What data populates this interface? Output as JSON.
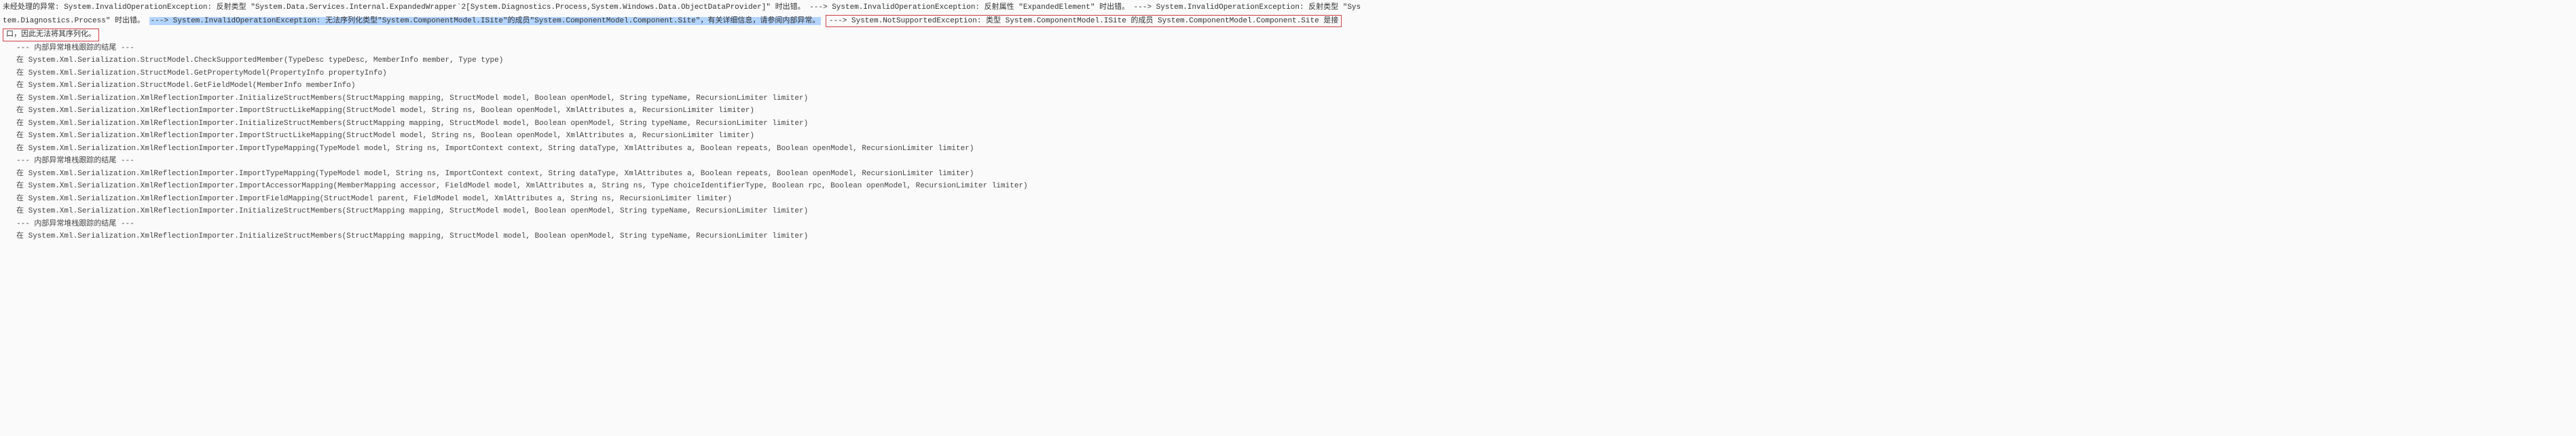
{
  "header": {
    "prefix": "未经处理的异常:  System.InvalidOperationException: 反射类型",
    "type1": "\"System.Data.Services.Internal.ExpandedWrapper`2[System.Diagnostics.Process,System.Windows.Data.ObjectDataProvider]\"",
    "err1": "时出错。 ---> System.InvalidOperationException: 反射属性",
    "prop1": "\"ExpandedElement\"",
    "err2": "时出错。 ---> System.InvalidOperationException: 反射类型",
    "type2": "\"Sys",
    "line2_start": "tem.Diagnostics.Process\"",
    "line2_err": "时出错。",
    "highlighted": "---> System.InvalidOperationException: 无法序列化类型\"System.ComponentModel.ISite\"的成员\"System.ComponentModel.Component.Site\"，有关详细信息，请参阅内部异常。",
    "boxed1": "---> System.NotSupportedException: 类型 System.ComponentModel.ISite 的成员 System.ComponentModel.Component.Site 是接",
    "boxed2": "口，因此无法将其序列化。"
  },
  "traces": [
    "   --- 内部异常堆栈跟踪的结尾 ---",
    "   在 System.Xml.Serialization.StructModel.CheckSupportedMember(TypeDesc typeDesc, MemberInfo member, Type type)",
    "   在 System.Xml.Serialization.StructModel.GetPropertyModel(PropertyInfo propertyInfo)",
    "   在 System.Xml.Serialization.StructModel.GetFieldModel(MemberInfo memberInfo)",
    "   在 System.Xml.Serialization.XmlReflectionImporter.InitializeStructMembers(StructMapping mapping, StructModel model, Boolean openModel, String typeName, RecursionLimiter limiter)",
    "   在 System.Xml.Serialization.XmlReflectionImporter.ImportStructLikeMapping(StructModel model, String ns, Boolean openModel, XmlAttributes a, RecursionLimiter limiter)",
    "   在 System.Xml.Serialization.XmlReflectionImporter.InitializeStructMembers(StructMapping mapping, StructModel model, Boolean openModel, String typeName, RecursionLimiter limiter)",
    "   在 System.Xml.Serialization.XmlReflectionImporter.ImportStructLikeMapping(StructModel model, String ns, Boolean openModel, XmlAttributes a, RecursionLimiter limiter)",
    "   在 System.Xml.Serialization.XmlReflectionImporter.ImportTypeMapping(TypeModel model, String ns, ImportContext context, String dataType, XmlAttributes a, Boolean repeats, Boolean openModel, RecursionLimiter limiter)",
    "   --- 内部异常堆栈跟踪的结尾 ---",
    "   在 System.Xml.Serialization.XmlReflectionImporter.ImportTypeMapping(TypeModel model, String ns, ImportContext context, String dataType, XmlAttributes a, Boolean repeats, Boolean openModel, RecursionLimiter limiter)",
    "   在 System.Xml.Serialization.XmlReflectionImporter.ImportAccessorMapping(MemberMapping accessor, FieldModel model, XmlAttributes a, String ns, Type choiceIdentifierType, Boolean rpc, Boolean openModel, RecursionLimiter limiter)",
    "   在 System.Xml.Serialization.XmlReflectionImporter.ImportFieldMapping(StructModel parent, FieldModel model, XmlAttributes a, String ns, RecursionLimiter limiter)",
    "   在 System.Xml.Serialization.XmlReflectionImporter.InitializeStructMembers(StructMapping mapping, StructModel model, Boolean openModel, String typeName, RecursionLimiter limiter)",
    "   --- 内部异常堆栈跟踪的结尾 ---",
    "   在 System.Xml.Serialization.XmlReflectionImporter.InitializeStructMembers(StructMapping mapping, StructModel model, Boolean openModel, String typeName, RecursionLimiter limiter)"
  ]
}
